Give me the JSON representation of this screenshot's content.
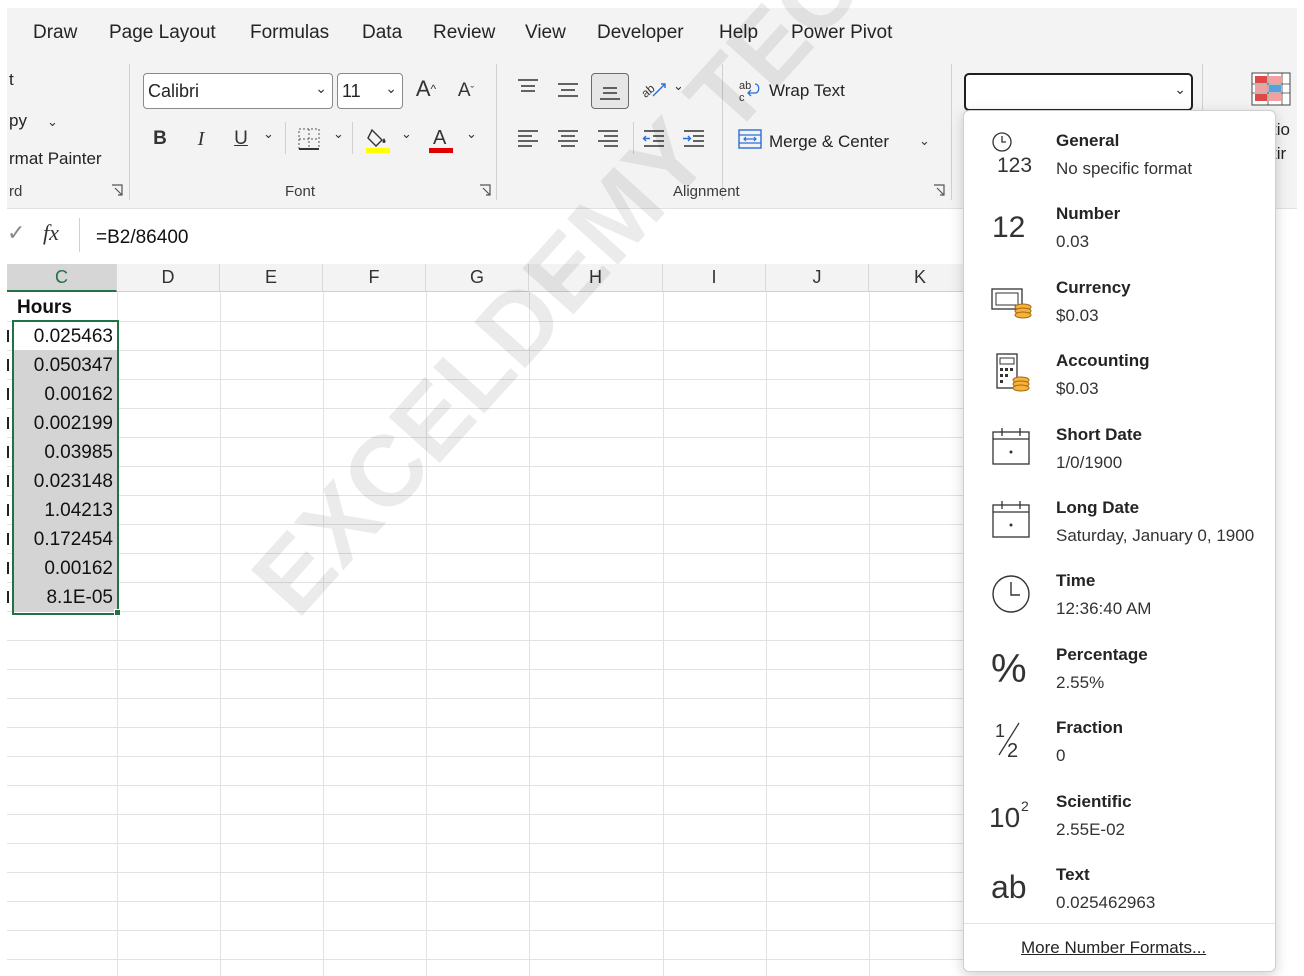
{
  "menu": {
    "tabs": [
      "Draw",
      "Page Layout",
      "Formulas",
      "Data",
      "Review",
      "View",
      "Developer",
      "Help",
      "Power Pivot"
    ]
  },
  "clipboard": {
    "cut_label": "t",
    "copy_label": "py",
    "format_painter_label": "rmat Painter",
    "group_label": "rd"
  },
  "font": {
    "name": "Calibri",
    "size": "11",
    "bold_label": "B",
    "italic_label": "I",
    "underline_label": "U",
    "group_label": "Font",
    "fill_color": "#ffff00",
    "font_color": "#e00000"
  },
  "alignment": {
    "wrap_text_label": "Wrap Text",
    "merge_center_label": "Merge & Center",
    "group_label": "Alignment"
  },
  "number_format": {
    "current_value": "",
    "options": [
      {
        "name": "General",
        "example": "No specific format",
        "icon": "clock-123-icon"
      },
      {
        "name": "Number",
        "example": "0.03",
        "icon": "number-12-icon"
      },
      {
        "name": "Currency",
        "example": "$0.03",
        "icon": "currency-icon"
      },
      {
        "name": "Accounting",
        "example": " $0.03",
        "icon": "accounting-icon"
      },
      {
        "name": "Short Date",
        "example": "1/0/1900",
        "icon": "calendar-icon"
      },
      {
        "name": "Long Date",
        "example": "Saturday, January 0, 1900",
        "icon": "calendar-icon"
      },
      {
        "name": "Time",
        "example": "12:36:40 AM",
        "icon": "clock-icon"
      },
      {
        "name": "Percentage",
        "example": "2.55%",
        "icon": "percent-icon"
      },
      {
        "name": "Fraction",
        "example": "0",
        "icon": "fraction-icon"
      },
      {
        "name": "Scientific",
        "example": "2.55E-02",
        "icon": "scientific-icon"
      },
      {
        "name": "Text",
        "example": "0.025462963",
        "icon": "text-ab-icon"
      }
    ],
    "more_label": "More Number Formats..."
  },
  "right_partial": {
    "line1": "tio",
    "line2": "tir"
  },
  "formula_bar": {
    "fx_label": "fx",
    "formula": "=B2/86400"
  },
  "sheet": {
    "columns": [
      "C",
      "D",
      "E",
      "F",
      "G",
      "H",
      "I",
      "J",
      "K"
    ],
    "header_cell": "Hours",
    "values": [
      "0.025463",
      "0.050347",
      "0.00162",
      "0.002199",
      "0.03985",
      "0.023148",
      "1.04213",
      "0.172454",
      "0.00162",
      "8.1E-05"
    ],
    "selection_color": "#217346"
  },
  "watermark": "EXCELDEMY TECHNOLOGY.COM"
}
